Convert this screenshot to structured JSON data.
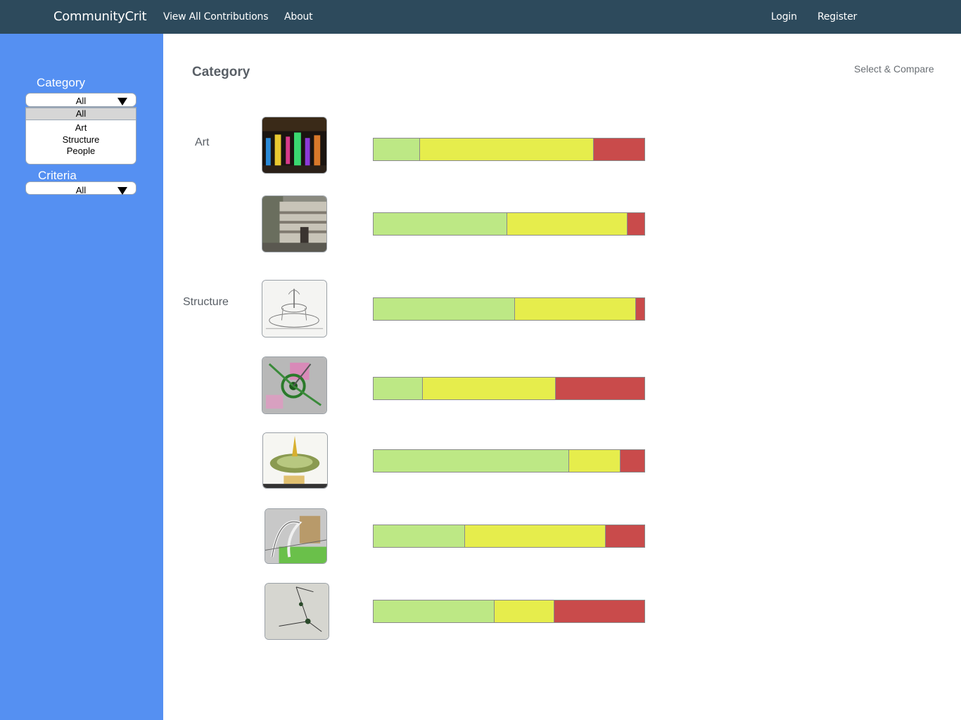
{
  "nav": {
    "brand": "CommunityCrit",
    "view_all": "View All Contributions",
    "about": "About",
    "login": "Login",
    "register": "Register",
    "bg_color": "#2d4a5c"
  },
  "sidebar": {
    "bg_color": "#5590f2",
    "category_label": "Category",
    "category_value": "All",
    "category_options": [
      "All",
      "Art",
      "Structure",
      "People"
    ],
    "criteria_label": "Criteria",
    "criteria_value": "All"
  },
  "main": {
    "title": "Category",
    "compare_link": "Select & Compare",
    "groups": [
      "Art",
      "Structure"
    ]
  },
  "colors": {
    "green": "#bde885",
    "yellow": "#e6ed4c",
    "red": "#c94b4b"
  },
  "rows": [
    {
      "group": "Art",
      "thumb_icon": "night-exhibit-photo-icon",
      "values": [
        0.17,
        0.64,
        0.19
      ]
    },
    {
      "group": "Art",
      "thumb_icon": "wall-sculpture-photo-icon",
      "values": [
        0.49,
        0.445,
        0.065
      ]
    },
    {
      "group": "Structure",
      "thumb_icon": "fountain-sketch-icon",
      "values": [
        0.52,
        0.445,
        0.035
      ]
    },
    {
      "group": "Structure",
      "thumb_icon": "site-plan-icon",
      "values": [
        0.18,
        0.49,
        0.33
      ]
    },
    {
      "group": "Structure",
      "thumb_icon": "park-rendering-icon",
      "values": [
        0.72,
        0.19,
        0.09
      ]
    },
    {
      "group": "Structure",
      "thumb_icon": "arch-model-icon",
      "values": [
        0.335,
        0.52,
        0.145
      ]
    },
    {
      "group": "Structure",
      "thumb_icon": "wire-sculpture-photo-icon",
      "values": [
        0.445,
        0.22,
        0.335
      ]
    }
  ]
}
